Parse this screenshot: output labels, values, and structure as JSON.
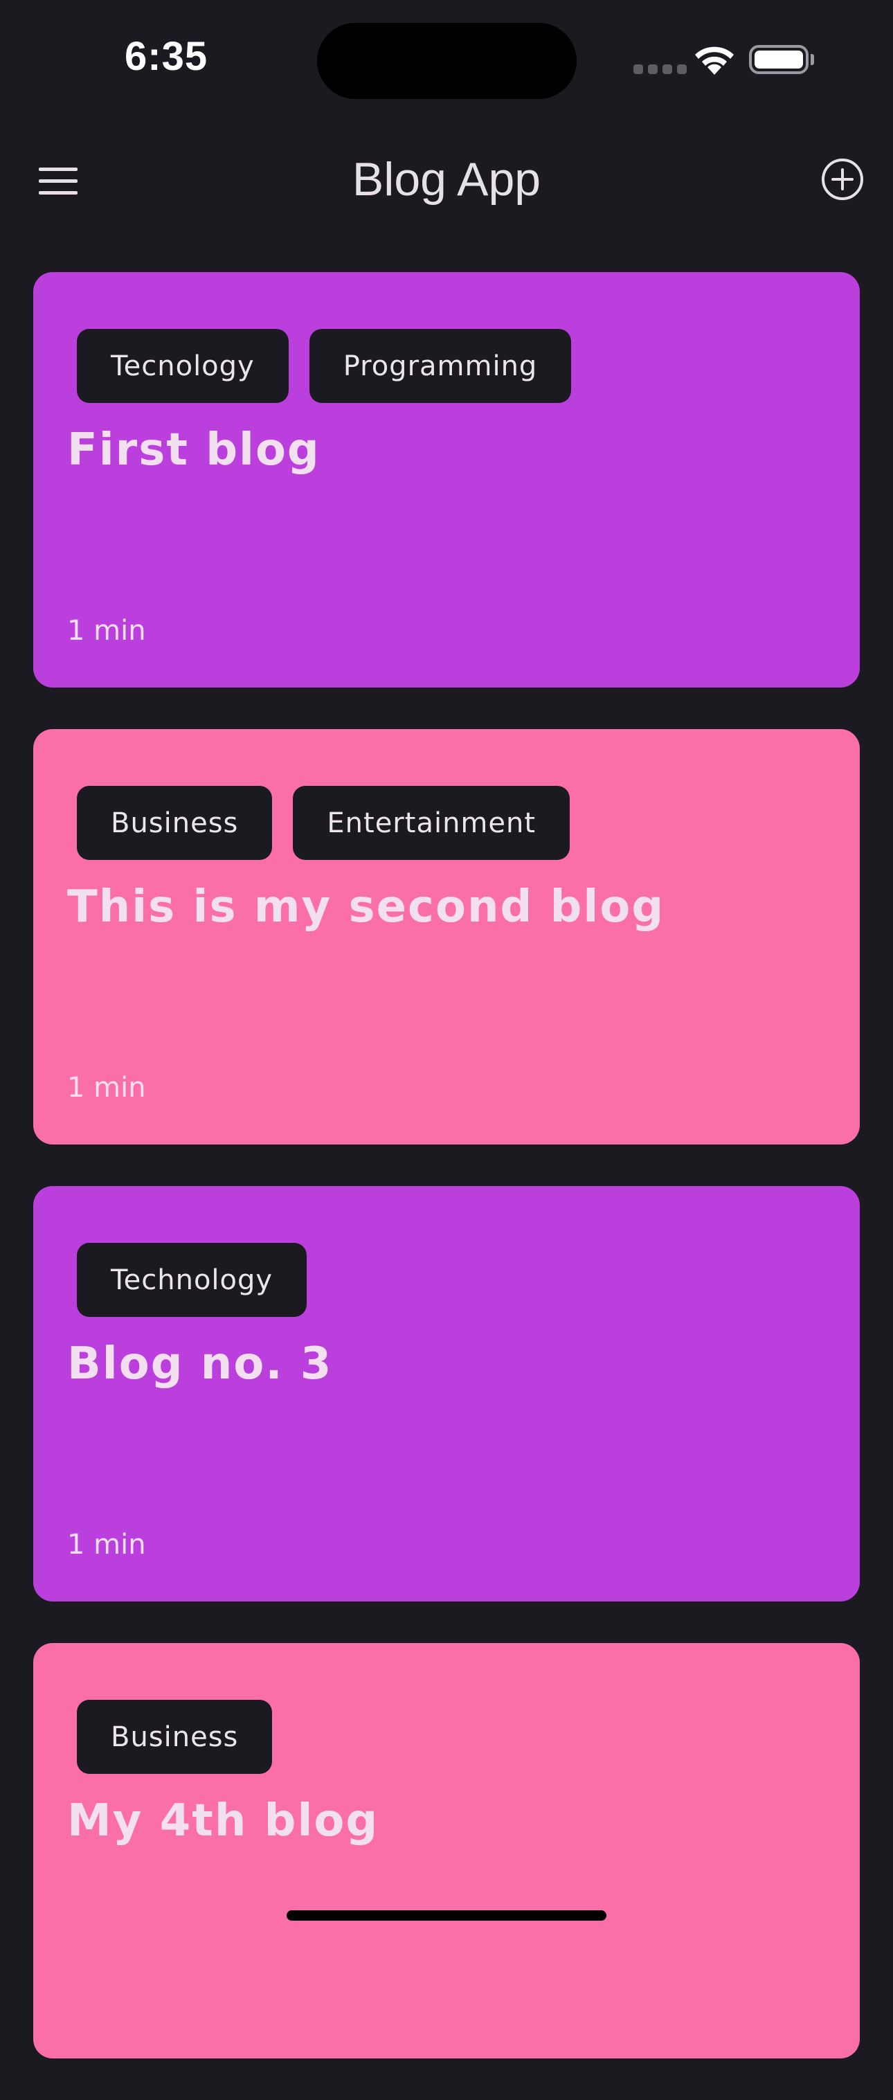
{
  "status_bar": {
    "time": "6:35"
  },
  "header": {
    "title": "Blog App",
    "menu_icon": "hamburger-menu-icon",
    "add_icon": "plus-circle-icon"
  },
  "colors": {
    "background": "#1b1a20",
    "card_purple": "#bb3fdd",
    "card_pink": "#fb6fa9",
    "tag_background": "#1b1a20",
    "text_light": "#f2dff0"
  },
  "blogs": [
    {
      "tags": [
        "Tecnology",
        "Programming"
      ],
      "title": "First blog",
      "read_time": "1 min",
      "color": "#bb3fdd"
    },
    {
      "tags": [
        "Business",
        "Entertainment"
      ],
      "title": "This is my second blog",
      "read_time": "1 min",
      "color": "#fb6fa9"
    },
    {
      "tags": [
        "Technology"
      ],
      "title": "Blog no. 3",
      "read_time": "1 min",
      "color": "#bb3fdd"
    },
    {
      "tags": [
        "Business"
      ],
      "title": "My 4th blog",
      "read_time": "",
      "color": "#fb6fa9"
    }
  ]
}
